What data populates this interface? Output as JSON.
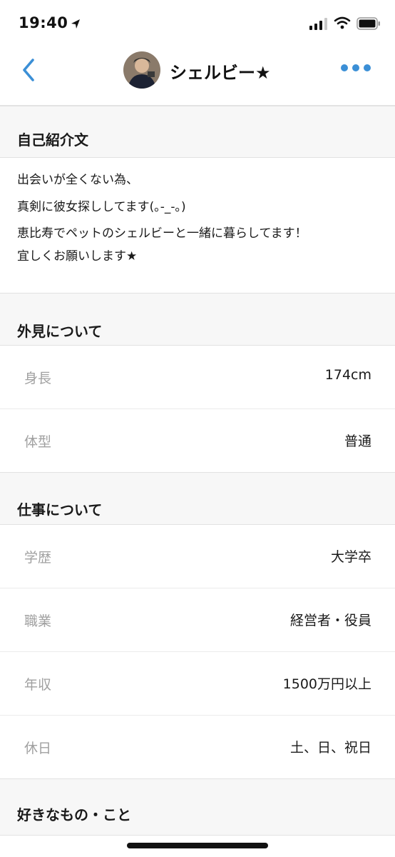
{
  "status_bar": {
    "time": "19:40"
  },
  "nav": {
    "title": "シェルビー★"
  },
  "sections": {
    "intro": {
      "header": "自己紹介文",
      "lines": [
        "出会いが全くない為、",
        "真剣に彼女探ししてます(｡-_-｡)",
        "恵比寿でペットのシェルビーと一緒に暮らしてます！",
        "宜しくお願いします★"
      ]
    },
    "appearance": {
      "header": "外見について",
      "rows": [
        {
          "label": "身長",
          "value": "174cm"
        },
        {
          "label": "体型",
          "value": "普通"
        }
      ]
    },
    "work": {
      "header": "仕事について",
      "rows": [
        {
          "label": "学歴",
          "value": "大学卒"
        },
        {
          "label": "職業",
          "value": "経営者・役員"
        },
        {
          "label": "年収",
          "value": "1500万円以上"
        },
        {
          "label": "休日",
          "value": "土、日、祝日"
        }
      ]
    },
    "likes": {
      "header": "好きなもの・こと"
    }
  },
  "colors": {
    "accent": "#3b8fd6",
    "label_gray": "#a0a0a0",
    "header_bg": "#f7f7f7"
  }
}
